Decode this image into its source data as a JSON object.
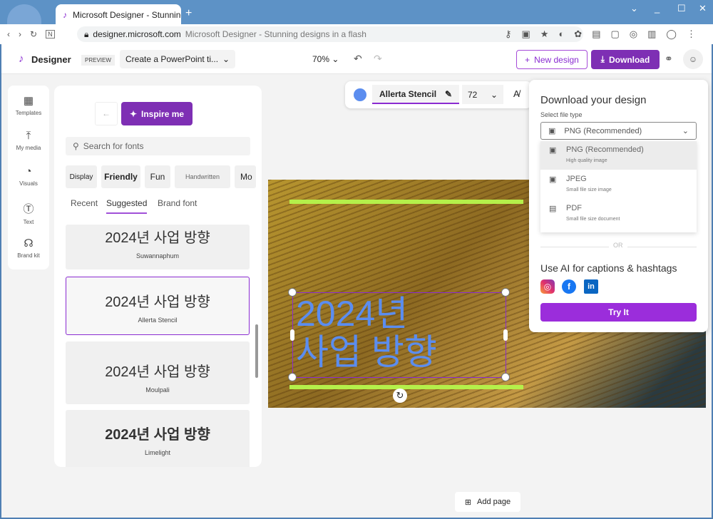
{
  "browser": {
    "tab_title": "Microsoft Designer - Stunning designs in a flash",
    "url_domain": "designer.microsoft.com",
    "url_title": "Microsoft Designer - Stunning designs in a flash"
  },
  "header": {
    "logo": "Designer",
    "badge": "PREVIEW",
    "project": "Create a PowerPoint ti...",
    "zoom": "70%",
    "new_design": "New design",
    "download": "Download"
  },
  "rail": [
    {
      "label": "Templates",
      "icon": "templates-icon"
    },
    {
      "label": "My media",
      "icon": "upload-icon"
    },
    {
      "label": "Visuals",
      "icon": "visuals-icon"
    },
    {
      "label": "Text",
      "icon": "text-icon"
    },
    {
      "label": "Brand kit",
      "icon": "brand-kit-icon"
    }
  ],
  "fonts": {
    "inspire": "Inspire me",
    "search_placeholder": "Search for fonts",
    "chips": [
      "Display",
      "Friendly",
      "Fun",
      "Handwritten",
      "Mo"
    ],
    "tabs": [
      "Recent",
      "Suggested",
      "Brand font"
    ],
    "active_tab": "Suggested",
    "cards": [
      {
        "sample": "2024년 사업 방향",
        "name": "Suwannaphum"
      },
      {
        "sample": "2024년 사업 방향",
        "name": "Allerta Stencil"
      },
      {
        "sample": "2024년 사업 방향",
        "name": "Moulpali"
      },
      {
        "sample": "2024년 사업 방향",
        "name": "Limelight"
      }
    ]
  },
  "toolbar": {
    "font": "Allerta Stencil",
    "size": "72",
    "color": "#5b8def"
  },
  "canvas": {
    "line1": "2024년",
    "line2": "사업 방향",
    "accent": "#b5f04a"
  },
  "download_panel": {
    "title": "Download your design",
    "select_label": "Select file type",
    "selected": "PNG (Recommended)",
    "options": [
      {
        "name": "PNG (Recommended)",
        "desc": "High quality image"
      },
      {
        "name": "JPEG",
        "desc": "Small file size image"
      },
      {
        "name": "PDF",
        "desc": "Small file size document"
      }
    ],
    "or": "OR",
    "ai_title": "Use AI for captions & hashtags",
    "try": "Try It"
  },
  "add_page": "Add page"
}
